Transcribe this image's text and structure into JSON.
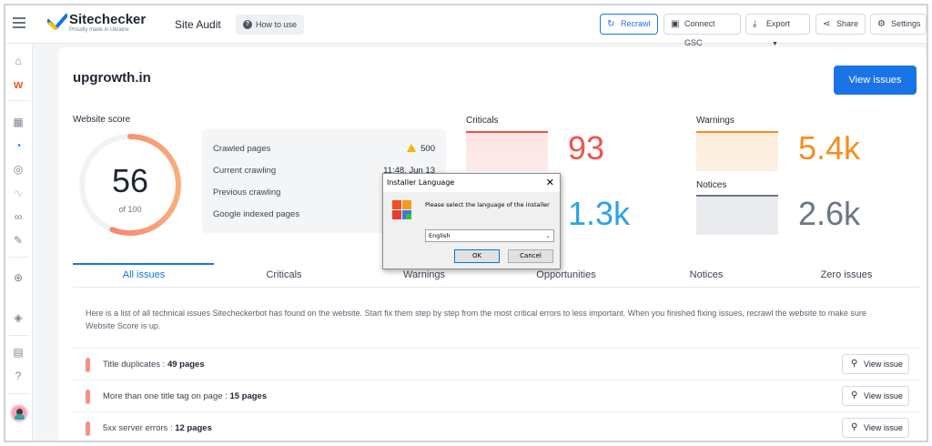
{
  "header": {
    "brand": "Sitechecker",
    "tagline": "Proudly made in Ukraine",
    "section": "Site Audit",
    "how_to_use": "How to use",
    "recrawl": "Recrawl",
    "connect_gsc": "Connect GSC",
    "export": "Export",
    "share": "Share",
    "settings": "Settings"
  },
  "main": {
    "domain": "upgrowth.in",
    "view_issues": "View issues",
    "website_score_label": "Website score",
    "score": "56",
    "score_of": "of 100",
    "score_fraction": 0.56,
    "info": [
      {
        "label": "Crawled pages",
        "value": "500"
      },
      {
        "label": "Current crawling",
        "value": "11:48, Jun 13"
      },
      {
        "label": "Previous crawling",
        "value": ""
      },
      {
        "label": "Google indexed pages",
        "value": ""
      }
    ],
    "metrics": {
      "criticals": {
        "label": "Criticals",
        "value": "93",
        "color": "#f0524a"
      },
      "opportunities": {
        "value": "1.3k",
        "color": "#2aa3e6"
      },
      "warnings": {
        "label": "Warnings",
        "value": "5.4k",
        "color": "#f58e1f"
      },
      "notices": {
        "label": "Notices",
        "value": "2.6k",
        "color": "#6d7685"
      }
    },
    "tabs": [
      "All issues",
      "Criticals",
      "Warnings",
      "Opportunities",
      "Notices",
      "Zero issues"
    ],
    "description": "Here is a list of all technical issues Sitecheckerbot has found on the website. Start fix them step by step from the most critical errors to less important. When you finished fixing issues, recrawl the website to make sure Website Score is up.",
    "issues": [
      {
        "label": "Title duplicates :",
        "count": "49 pages",
        "button": "View issue"
      },
      {
        "label": "More than one title tag on page :",
        "count": "15 pages",
        "button": "View issue"
      },
      {
        "label": "5xx server errors :",
        "count": "12 pages",
        "button": "View issue"
      }
    ]
  },
  "dialog": {
    "title": "Installer Language",
    "close": "✕",
    "message": "Please select the language of the installer",
    "selected_language": "English",
    "ok": "OK",
    "cancel": "Cancel"
  },
  "colors": {
    "accent": "#1b73e8",
    "critical_bar": "#f3938a"
  }
}
